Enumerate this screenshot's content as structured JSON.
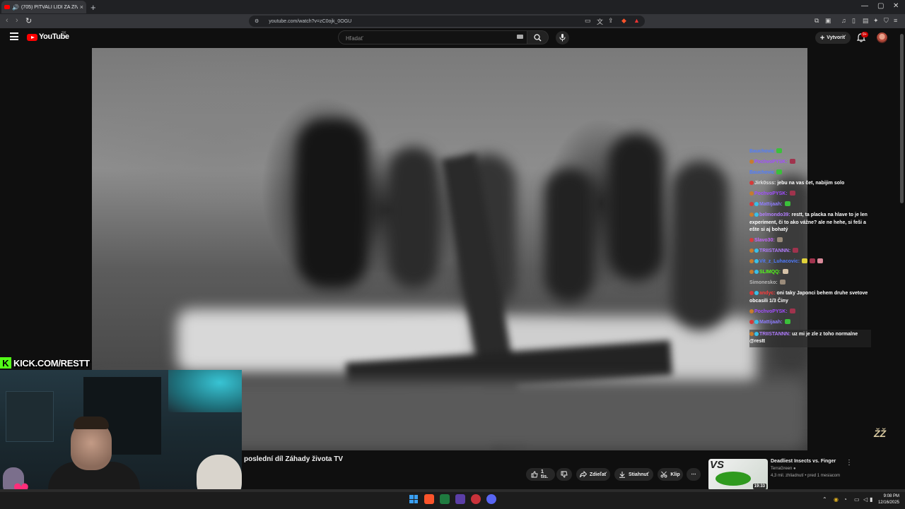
{
  "browser": {
    "tab_title": "(705) PITVALI LIDI ZA ŽIVA - ...",
    "tab_close": "×",
    "new_tab": "+",
    "url": "youtube.com/watch?v=zC0ojk_0OGU",
    "window_controls": [
      "—",
      "▢",
      "✕"
    ]
  },
  "youtube": {
    "wordmark": "YouTube",
    "country": "SK",
    "search_placeholder": "Hľadať",
    "create_label": "Vytvoriť",
    "notification_count": "9+"
  },
  "chat": [
    {
      "user": "Bauchovic",
      "message": "",
      "user_color": "#4f7cff",
      "badges": [],
      "emotes": [
        "#3bbf3b"
      ]
    },
    {
      "user": "PochvoPYSK:",
      "message": "",
      "user_color": "#a14dff",
      "badges": [
        "#c77b2e"
      ],
      "emotes": [
        "#a0334d"
      ]
    },
    {
      "user": "Bauchovic",
      "message": "",
      "user_color": "#4f7cff",
      "badges": [],
      "emotes": [
        "#3bbf3b"
      ]
    },
    {
      "user": "Jirk0sss:",
      "message": "jebu na vas čet, nabijim solo",
      "user_color": "#e0e0e0",
      "badges": [
        "#d63a3a"
      ],
      "emotes": []
    },
    {
      "user": "PochvoPYSK:",
      "message": "",
      "user_color": "#a14dff",
      "badges": [
        "#c77b2e"
      ],
      "emotes": [
        "#a0334d"
      ]
    },
    {
      "user": "Mattijaah:",
      "message": "",
      "user_color": "#8f7dff",
      "badges": [
        "#d63a3a",
        "#3ac0e8"
      ],
      "emotes": [
        "#3bbf3b"
      ]
    },
    {
      "user": "belmondo39:",
      "message": "restt, ta placka na hlave to je len experiment, či to ako vážne? ale ne hehe, si feši a ešte si aj bohatý",
      "user_color": "#b27dff",
      "badges": [
        "#c77b2e",
        "#3ac0e8"
      ],
      "emotes": []
    },
    {
      "user": "Slavo30:",
      "message": "",
      "user_color": "#c866ff",
      "badges": [
        "#d63a3a"
      ],
      "emotes": [
        "#9a8b7a"
      ]
    },
    {
      "user": "TRIISTANNN:",
      "message": "",
      "user_color": "#b27dff",
      "badges": [
        "#c77b2e",
        "#3ac0e8"
      ],
      "emotes": [
        "#a0334d"
      ]
    },
    {
      "user": "Vit_z_Luhacovic:",
      "message": "",
      "user_color": "#4f7cff",
      "badges": [
        "#c77b2e",
        "#3ac0e8"
      ],
      "emotes": [
        "#e0d23a",
        "#a0334d",
        "#d98a9a"
      ]
    },
    {
      "user": "SLIMQQ:",
      "message": "",
      "user_color": "#53fc18",
      "badges": [
        "#c77b2e",
        "#3ac0e8"
      ],
      "emotes": [
        "#d6c2a8"
      ]
    },
    {
      "user": "Simonesko:",
      "message": "",
      "user_color": "#b8b8b8",
      "badges": [],
      "emotes": [
        "#9a8b7a"
      ]
    },
    {
      "user": "andyc:",
      "message": "oni taky Japonci behem druhe svetove obcasili 1/3 Činy",
      "user_color": "#ff3c3c",
      "badges": [
        "#d63a3a",
        "#3ac0e8"
      ],
      "emotes": []
    },
    {
      "user": "PochvoPYSK:",
      "message": "",
      "user_color": "#a14dff",
      "badges": [
        "#c77b2e"
      ],
      "emotes": [
        "#a0334d"
      ]
    },
    {
      "user": "Mattijaah:",
      "message": "",
      "user_color": "#8f7dff",
      "badges": [
        "#d63a3a",
        "#3ac0e8"
      ],
      "emotes": [
        "#3bbf3b"
      ]
    },
    {
      "user": "TRIISTANNN:",
      "message": "uz mi je zle z toho normalne @restt",
      "user_color": "#b27dff",
      "badges": [
        "#c77b2e",
        "#3ac0e8"
      ],
      "emotes": [],
      "highlighted": true
    }
  ],
  "stream_overlay": {
    "kick_logo": "K",
    "kick_url": "KICK.COM/RESTT",
    "watermark": "ŽŽ"
  },
  "video": {
    "title": "poslední díl Záhady života TV",
    "likes": "1 tis.",
    "share": "Zdieľať",
    "download": "Stiahnuť",
    "clip": "Klip",
    "more": "⋯"
  },
  "recommended": {
    "title": "Deadliest Insects vs. Finger",
    "channel": "TerraGreen",
    "meta": "4,3 mil. zhliadnutí • pred 1 mesiacom",
    "duration": "19:33",
    "thumb_text": "VS",
    "more": "⋮"
  },
  "taskbar": {
    "time": "9:08 PM",
    "date": "12/16/2025"
  },
  "colors": {
    "youtube_red": "#ff0000",
    "kick_green": "#53fc18",
    "background": "#0f0f0f"
  }
}
